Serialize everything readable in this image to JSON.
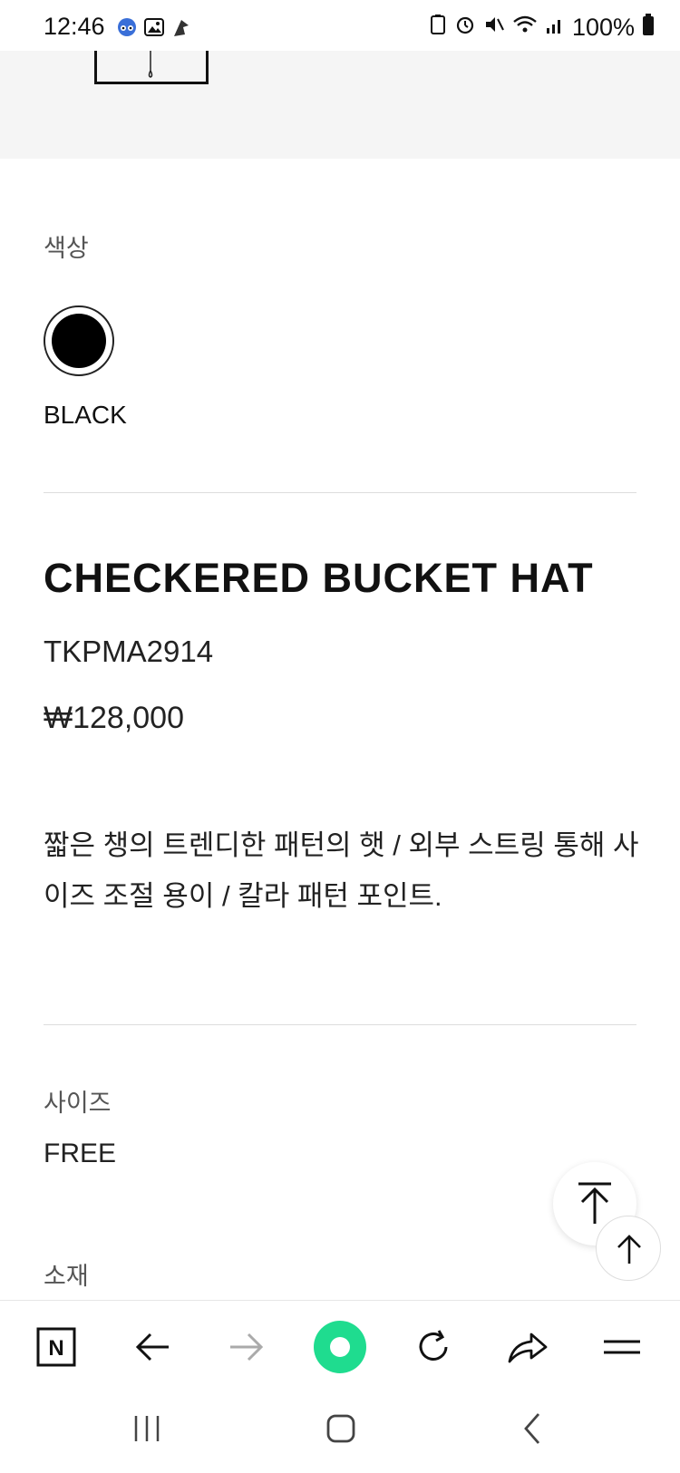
{
  "status_bar": {
    "time": "12:46",
    "battery": "100%",
    "left_icons": [
      "app-icon",
      "image-icon",
      "cursor-icon"
    ],
    "right_icons": [
      "battery-saver-icon",
      "alarm-icon",
      "mute-icon",
      "wifi-icon",
      "signal-icon",
      "battery-icon"
    ]
  },
  "color_section": {
    "label": "색상",
    "swatches": [
      {
        "name": "BLACK",
        "color": "#000000"
      }
    ]
  },
  "product": {
    "title": "CHECKERED BUCKET HAT",
    "code": "TKPMA2914",
    "price": "₩128,000",
    "description": "짧은 챙의 트렌디한 패턴의 햇 / 외부 스트링 통해 사이즈 조절 용이 / 칼라 패턴 포인트."
  },
  "size_section": {
    "label": "사이즈",
    "value": "FREE"
  },
  "material_section": {
    "label": "소재"
  },
  "toolbar": {
    "items": [
      "n-home-icon",
      "back-arrow-icon",
      "forward-arrow-icon",
      "green-circle-icon",
      "refresh-icon",
      "share-icon",
      "menu-icon"
    ]
  },
  "system_nav": {
    "items": [
      "recent-apps-icon",
      "home-icon",
      "back-icon"
    ]
  },
  "colors": {
    "accent_green": "#1fdc8f",
    "text": "#111111",
    "muted": "#555555"
  }
}
